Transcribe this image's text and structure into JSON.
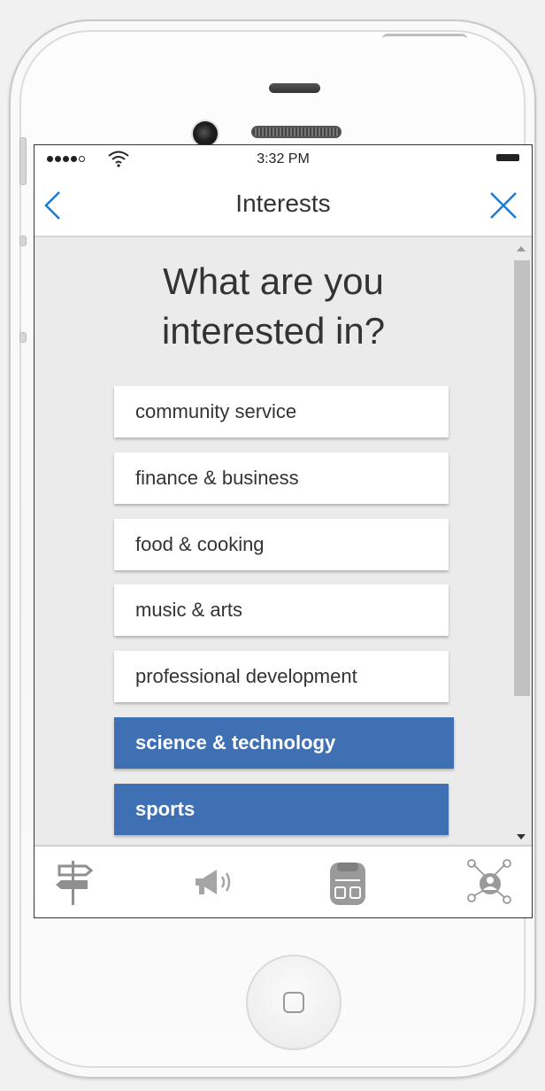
{
  "status_bar": {
    "time": "3:32 PM",
    "icons": [
      "signal-dots-icon",
      "wifi-icon",
      "battery-icon"
    ]
  },
  "nav": {
    "title": "Interests",
    "back_icon": "chevron-left-icon",
    "close_icon": "close-icon"
  },
  "heading": {
    "line1": "What are you",
    "line2": "interested in?"
  },
  "options": [
    {
      "label": "community service",
      "selected": false
    },
    {
      "label": "finance & business",
      "selected": false
    },
    {
      "label": "food & cooking",
      "selected": false
    },
    {
      "label": "music & arts",
      "selected": false
    },
    {
      "label": "professional development",
      "selected": false
    },
    {
      "label": "science & technology",
      "selected": true
    },
    {
      "label": "sports",
      "selected": true
    }
  ],
  "tab_bar": {
    "tabs": [
      {
        "icon": "signpost-icon"
      },
      {
        "icon": "megaphone-icon"
      },
      {
        "icon": "backpack-icon"
      },
      {
        "icon": "network-person-icon"
      }
    ]
  },
  "colors": {
    "accent_blue": "#1a7ad9",
    "selected_option": "#4070b4",
    "tab_icon_gray": "#9a9a9a"
  }
}
